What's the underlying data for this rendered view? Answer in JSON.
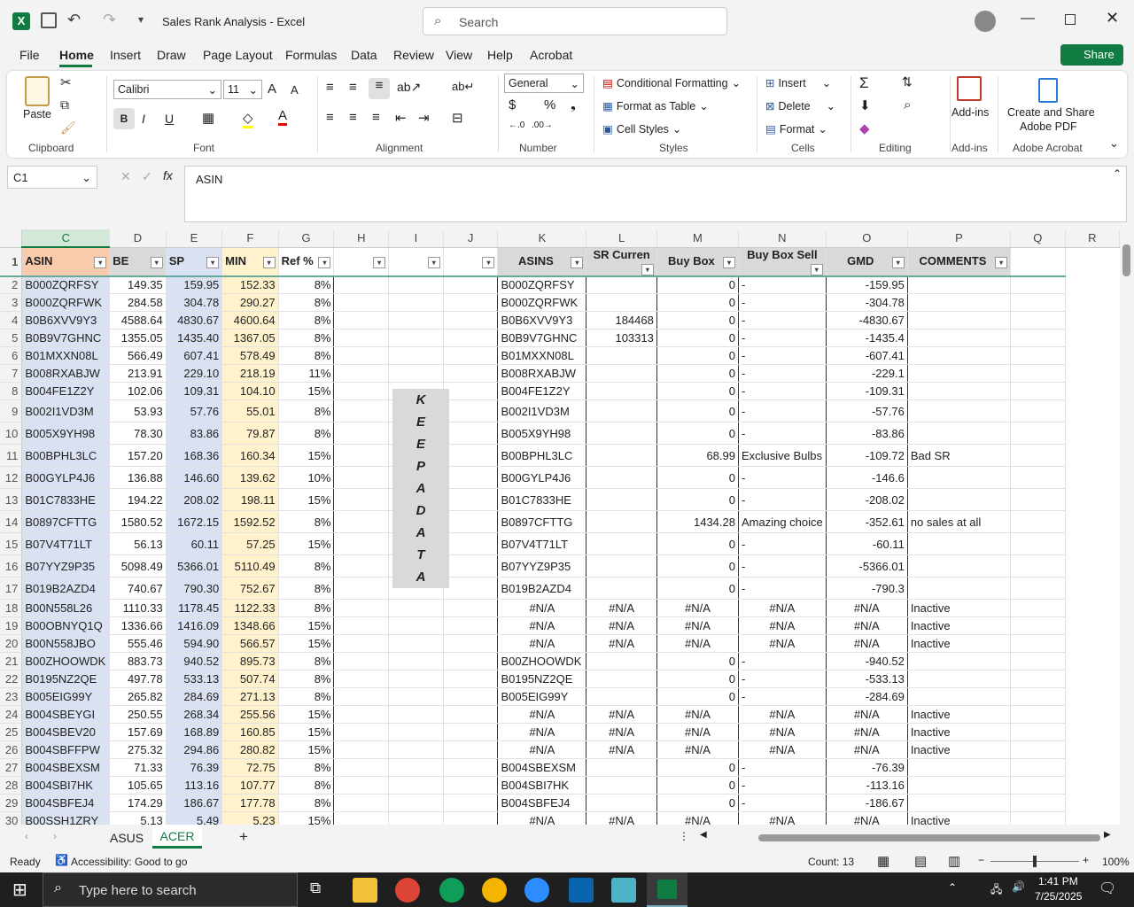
{
  "titlebar": {
    "title": "Sales Rank Analysis  -  Excel",
    "search_placeholder": "Search"
  },
  "menu": [
    "File",
    "Home",
    "Insert",
    "Draw",
    "Page Layout",
    "Formulas",
    "Data",
    "Review",
    "View",
    "Help",
    "Acrobat"
  ],
  "share_label": "Share",
  "ribbon": {
    "clipboard": {
      "paste": "Paste",
      "label": "Clipboard"
    },
    "font": {
      "name": "Calibri",
      "size": "11",
      "label": "Font"
    },
    "alignment": {
      "label": "Alignment"
    },
    "number": {
      "format": "General",
      "label": "Number"
    },
    "styles": {
      "cond": "Conditional Formatting",
      "table": "Format as Table",
      "cell": "Cell Styles",
      "label": "Styles"
    },
    "cells": {
      "insert": "Insert",
      "delete": "Delete",
      "format": "Format",
      "label": "Cells"
    },
    "editing": {
      "label": "Editing"
    },
    "addins": {
      "btn": "Add-ins",
      "label": "Add-ins"
    },
    "acrobat": {
      "btn1": "Create and Share",
      "btn2": "Adobe PDF",
      "label": "Adobe Acrobat"
    }
  },
  "formula_bar": {
    "namebox": "C1",
    "content": "ASIN"
  },
  "columns": [
    "C",
    "D",
    "E",
    "F",
    "G",
    "H",
    "I",
    "J",
    "K",
    "L",
    "M",
    "N",
    "O",
    "P",
    "Q",
    "R"
  ],
  "header_row": [
    "ASIN",
    "BE",
    "SP",
    "MIN",
    "Ref %",
    "",
    "",
    "",
    "ASINS",
    "SR Curren",
    "Buy Box",
    "Buy Box Sell",
    "GMD",
    "COMMENTS",
    ""
  ],
  "keepadata": [
    "K",
    "E",
    "E",
    "P",
    "A",
    "D",
    "A",
    "T",
    "A"
  ],
  "rows": [
    [
      "2",
      "B000ZQRFSY",
      "149.35",
      "159.95",
      "152.33",
      "8%",
      "B000ZQRFSY",
      "",
      "0",
      "-",
      "-159.95",
      ""
    ],
    [
      "3",
      "B000ZQRFWK",
      "284.58",
      "304.78",
      "290.27",
      "8%",
      "B000ZQRFWK",
      "",
      "0",
      "-",
      "-304.78",
      ""
    ],
    [
      "4",
      "B0B6XVV9Y3",
      "4588.64",
      "4830.67",
      "4600.64",
      "8%",
      "B0B6XVV9Y3",
      "184468",
      "0",
      "-",
      "-4830.67",
      ""
    ],
    [
      "5",
      "B0B9V7GHNC",
      "1355.05",
      "1435.40",
      "1367.05",
      "8%",
      "B0B9V7GHNC",
      "103313",
      "0",
      "-",
      "-1435.4",
      ""
    ],
    [
      "6",
      "B01MXXN08L",
      "566.49",
      "607.41",
      "578.49",
      "8%",
      "B01MXXN08L",
      "",
      "0",
      "-",
      "-607.41",
      ""
    ],
    [
      "7",
      "B008RXABJW",
      "213.91",
      "229.10",
      "218.19",
      "11%",
      "B008RXABJW",
      "",
      "0",
      "-",
      "-229.1",
      ""
    ],
    [
      "8",
      "B004FE1Z2Y",
      "102.06",
      "109.31",
      "104.10",
      "15%",
      "B004FE1Z2Y",
      "",
      "0",
      "-",
      "-109.31",
      ""
    ],
    [
      "9",
      "B002I1VD3M",
      "53.93",
      "57.76",
      "55.01",
      "8%",
      "B002I1VD3M",
      "",
      "0",
      "-",
      "-57.76",
      ""
    ],
    [
      "10",
      "B005X9YH98",
      "78.30",
      "83.86",
      "79.87",
      "8%",
      "B005X9YH98",
      "",
      "0",
      "-",
      "-83.86",
      ""
    ],
    [
      "11",
      "B00BPHL3LC",
      "157.20",
      "168.36",
      "160.34",
      "15%",
      "B00BPHL3LC",
      "",
      "68.99",
      "Exclusive Bulbs",
      "-109.72",
      "Bad SR"
    ],
    [
      "12",
      "B00GYLP4J6",
      "136.88",
      "146.60",
      "139.62",
      "10%",
      "B00GYLP4J6",
      "",
      "0",
      "-",
      "-146.6",
      ""
    ],
    [
      "13",
      "B01C7833HE",
      "194.22",
      "208.02",
      "198.11",
      "15%",
      "B01C7833HE",
      "",
      "0",
      "-",
      "-208.02",
      ""
    ],
    [
      "14",
      "B0897CFTTG",
      "1580.52",
      "1672.15",
      "1592.52",
      "8%",
      "B0897CFTTG",
      "",
      "1434.28",
      "Amazing choice",
      "-352.61",
      "no sales at all"
    ],
    [
      "15",
      "B07V4T71LT",
      "56.13",
      "60.11",
      "57.25",
      "15%",
      "B07V4T71LT",
      "",
      "0",
      "-",
      "-60.11",
      ""
    ],
    [
      "16",
      "B07YYZ9P35",
      "5098.49",
      "5366.01",
      "5110.49",
      "8%",
      "B07YYZ9P35",
      "",
      "0",
      "-",
      "-5366.01",
      ""
    ],
    [
      "17",
      "B019B2AZD4",
      "740.67",
      "790.30",
      "752.67",
      "8%",
      "B019B2AZD4",
      "",
      "0",
      "-",
      "-790.3",
      ""
    ],
    [
      "18",
      "B00N558L26",
      "1110.33",
      "1178.45",
      "1122.33",
      "8%",
      "#N/A",
      "#N/A",
      "#N/A",
      "#N/A",
      "#N/A",
      "Inactive"
    ],
    [
      "19",
      "B00OBNYQ1Q",
      "1336.66",
      "1416.09",
      "1348.66",
      "15%",
      "#N/A",
      "#N/A",
      "#N/A",
      "#N/A",
      "#N/A",
      "Inactive"
    ],
    [
      "20",
      "B00N558JBO",
      "555.46",
      "594.90",
      "566.57",
      "15%",
      "#N/A",
      "#N/A",
      "#N/A",
      "#N/A",
      "#N/A",
      "Inactive"
    ],
    [
      "21",
      "B00ZHOOWDK",
      "883.73",
      "940.52",
      "895.73",
      "8%",
      "B00ZHOOWDK",
      "",
      "0",
      "-",
      "-940.52",
      ""
    ],
    [
      "22",
      "B0195NZ2QE",
      "497.78",
      "533.13",
      "507.74",
      "8%",
      "B0195NZ2QE",
      "",
      "0",
      "-",
      "-533.13",
      ""
    ],
    [
      "23",
      "B005EIG99Y",
      "265.82",
      "284.69",
      "271.13",
      "8%",
      "B005EIG99Y",
      "",
      "0",
      "-",
      "-284.69",
      ""
    ],
    [
      "24",
      "B004SBEYGI",
      "250.55",
      "268.34",
      "255.56",
      "15%",
      "#N/A",
      "#N/A",
      "#N/A",
      "#N/A",
      "#N/A",
      "Inactive"
    ],
    [
      "25",
      "B004SBEV20",
      "157.69",
      "168.89",
      "160.85",
      "15%",
      "#N/A",
      "#N/A",
      "#N/A",
      "#N/A",
      "#N/A",
      "Inactive"
    ],
    [
      "26",
      "B004SBFFPW",
      "275.32",
      "294.86",
      "280.82",
      "15%",
      "#N/A",
      "#N/A",
      "#N/A",
      "#N/A",
      "#N/A",
      "Inactive"
    ],
    [
      "27",
      "B004SBEXSM",
      "71.33",
      "76.39",
      "72.75",
      "8%",
      "B004SBEXSM",
      "",
      "0",
      "-",
      "-76.39",
      ""
    ],
    [
      "28",
      "B004SBI7HK",
      "105.65",
      "113.16",
      "107.77",
      "8%",
      "B004SBI7HK",
      "",
      "0",
      "-",
      "-113.16",
      ""
    ],
    [
      "29",
      "B004SBFEJ4",
      "174.29",
      "186.67",
      "177.78",
      "8%",
      "B004SBFEJ4",
      "",
      "0",
      "-",
      "-186.67",
      ""
    ],
    [
      "30",
      "B00SSH1ZRY",
      "5.13",
      "5.49",
      "5.23",
      "15%",
      "#N/A",
      "#N/A",
      "#N/A",
      "#N/A",
      "#N/A",
      "Inactive"
    ]
  ],
  "sheets": [
    "ASUS",
    "ACER"
  ],
  "status": {
    "ready": "Ready",
    "accessibility": "Accessibility: Good to go",
    "count": "Count: 13",
    "zoom": "100%"
  },
  "taskbar": {
    "search": "Type here to search",
    "time": "1:41 PM",
    "date": "7/25/2025"
  }
}
